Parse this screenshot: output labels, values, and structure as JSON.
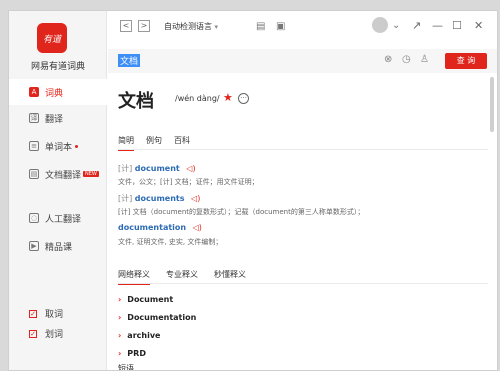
{
  "app": {
    "logo_text": "有道",
    "name": "网易有道词典"
  },
  "sidebar": {
    "items": [
      {
        "label": "词典",
        "icon": "A"
      },
      {
        "label": "翻译",
        "icon": "译"
      },
      {
        "label": "单词本",
        "icon": "≡"
      },
      {
        "label": "文档翻译",
        "icon": "▤",
        "badge": "NEW"
      },
      {
        "label": "人工翻译",
        "icon": "◌"
      },
      {
        "label": "精品课",
        "icon": "▶"
      }
    ],
    "checks": [
      {
        "label": "取词",
        "mark": "✓"
      },
      {
        "label": "划词",
        "mark": "✓"
      }
    ]
  },
  "toolbar": {
    "back": "<",
    "forward": ">",
    "lang": "自动检测语言",
    "lang_arrow": "▾",
    "icon1": "▤",
    "icon2": "▣",
    "user_arrow": "⌄",
    "w1": "↗",
    "w2": "—",
    "w3": "☐",
    "w4": "✕"
  },
  "search": {
    "value": "文档",
    "clear": "⊗",
    "history": "◷",
    "share": "♙",
    "button": "查 询"
  },
  "entry": {
    "word": "文档",
    "phonetic": "/wén dàng/",
    "star": "★",
    "more": "···",
    "tabs": [
      "简明",
      "例句",
      "百科"
    ],
    "defs": [
      {
        "tag": "[计]",
        "term": "document",
        "sound": "◁)"
      },
      {
        "tag": "[计]",
        "term": "documents",
        "sound": "◁)"
      },
      {
        "tag": "",
        "term": "documentation",
        "sound": "◁)"
      }
    ],
    "gloss": [
      "文件，公文；[计] 文档；证件；用文件证明；",
      "[计] 文档（document的复数形式）；记载（document的第三人称单数形式）；",
      "文件, 证明文件, 史实, 文件编制；"
    ],
    "tabs2": [
      "网络释义",
      "专业释义",
      "秒懂释义"
    ],
    "list": [
      "Document",
      "Documentation",
      "archive",
      "PRD"
    ],
    "partial": "短语"
  }
}
